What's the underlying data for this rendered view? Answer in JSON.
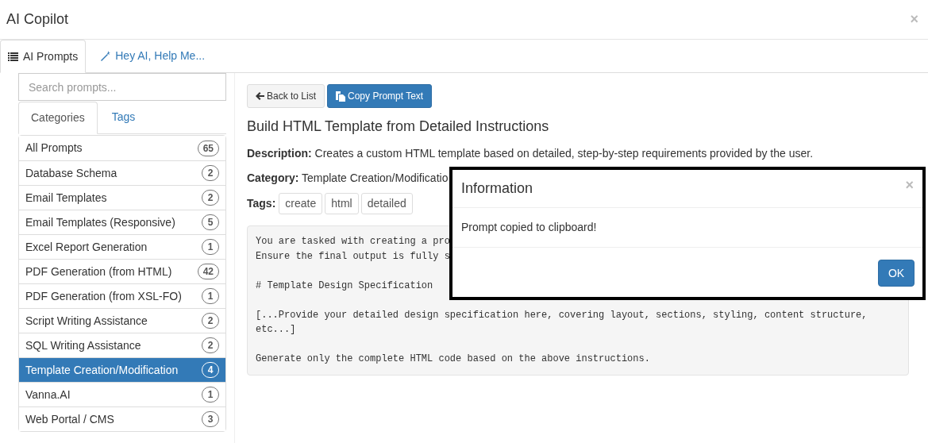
{
  "window": {
    "title": "AI Copilot",
    "close": "×"
  },
  "tabs": [
    {
      "label": "AI Prompts",
      "selected": true
    },
    {
      "label": "Hey AI, Help Me...",
      "selected": false
    }
  ],
  "search": {
    "placeholder": "Search prompts..."
  },
  "filter_tabs": [
    {
      "label": "Categories",
      "selected": true
    },
    {
      "label": "Tags",
      "selected": false
    }
  ],
  "categories": [
    {
      "name": "All Prompts",
      "count": "65",
      "selected": false
    },
    {
      "name": "Database Schema",
      "count": "2",
      "selected": false
    },
    {
      "name": "Email Templates",
      "count": "2",
      "selected": false
    },
    {
      "name": "Email Templates (Responsive)",
      "count": "5",
      "selected": false
    },
    {
      "name": "Excel Report Generation",
      "count": "1",
      "selected": false
    },
    {
      "name": "PDF Generation (from HTML)",
      "count": "42",
      "selected": false
    },
    {
      "name": "PDF Generation (from XSL-FO)",
      "count": "1",
      "selected": false
    },
    {
      "name": "Script Writing Assistance",
      "count": "2",
      "selected": false
    },
    {
      "name": "SQL Writing Assistance",
      "count": "2",
      "selected": false
    },
    {
      "name": "Template Creation/Modification",
      "count": "4",
      "selected": true
    },
    {
      "name": "Vanna.AI",
      "count": "1",
      "selected": false
    },
    {
      "name": "Web Portal / CMS",
      "count": "3",
      "selected": false
    }
  ],
  "detail": {
    "buttons": [
      {
        "label": "Back to List",
        "kind": "default"
      },
      {
        "label": "Copy Prompt Text",
        "kind": "primary"
      }
    ],
    "title": "Build HTML Template from Detailed Instructions",
    "description": "**Description:** Creates a custom HTML template based on detailed, step-by-step requirements provided by the user.",
    "category": "**Category:** Template Creation/Modificatio",
    "tags_label": "Tags:",
    "tags": [
      "create",
      "html",
      "detailed"
    ],
    "prompt_paragraphs": [
      "You are tasked with creating a pro\nEnsure the final output is fully s",
      "# Template Design Specification",
      "[...Provide your detailed design specification here, covering layout, sections, styling, content structure,\netc...]",
      "Generate only the complete HTML code based on the above instructions."
    ]
  },
  "dialog": {
    "title": "Information",
    "close": "×",
    "message": "Prompt copied to clipboard!",
    "button": "OK"
  }
}
